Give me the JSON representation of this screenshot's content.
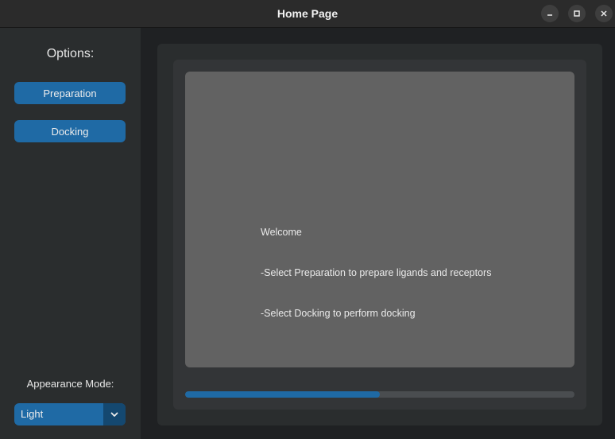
{
  "window": {
    "title": "Home Page",
    "controls": {
      "minimize": "minimize",
      "maximize": "maximize",
      "close": "close"
    }
  },
  "sidebar": {
    "heading": "Options:",
    "buttons": [
      {
        "label": "Preparation"
      },
      {
        "label": "Docking"
      }
    ],
    "appearance_label": "Appearance Mode:",
    "appearance_select": {
      "value": "Light",
      "icon": "chevron-down-icon"
    }
  },
  "main": {
    "text_lines": [
      "Welcome",
      "-Select Preparation to prepare ligands and receptors",
      "-Select Docking to perform docking"
    ],
    "progress": 0.5
  },
  "colors": {
    "accent": "#1f6aa5",
    "accent_dark": "#144870",
    "sidebar_bg": "#2a2d2e",
    "textbox_bg": "#626262"
  }
}
